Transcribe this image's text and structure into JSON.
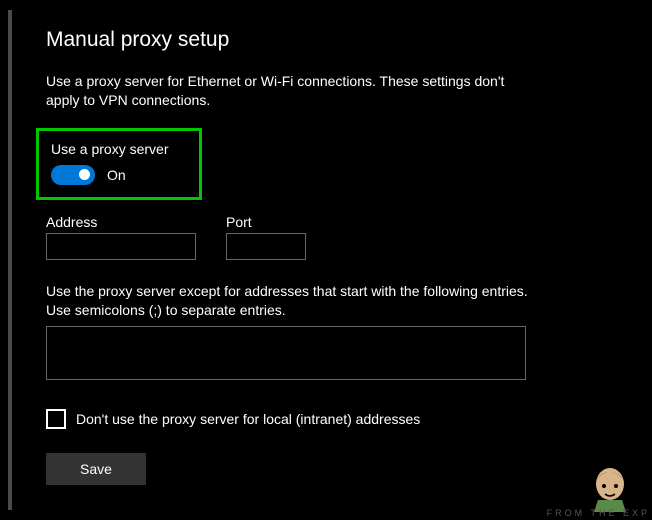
{
  "title": "Manual proxy setup",
  "description": "Use a proxy server for Ethernet or Wi-Fi connections. These settings don't apply to VPN connections.",
  "toggle": {
    "label": "Use a proxy server",
    "state": "On",
    "value": true
  },
  "fields": {
    "address": {
      "label": "Address",
      "value": ""
    },
    "port": {
      "label": "Port",
      "value": ""
    }
  },
  "exceptions": {
    "label": "Use the proxy server except for addresses that start with the following entries. Use semicolons (;) to separate entries.",
    "value": ""
  },
  "checkbox": {
    "label": "Don't use the proxy server for local (intranet) addresses",
    "checked": false
  },
  "save_label": "Save",
  "watermark": "FROM THE EXP"
}
